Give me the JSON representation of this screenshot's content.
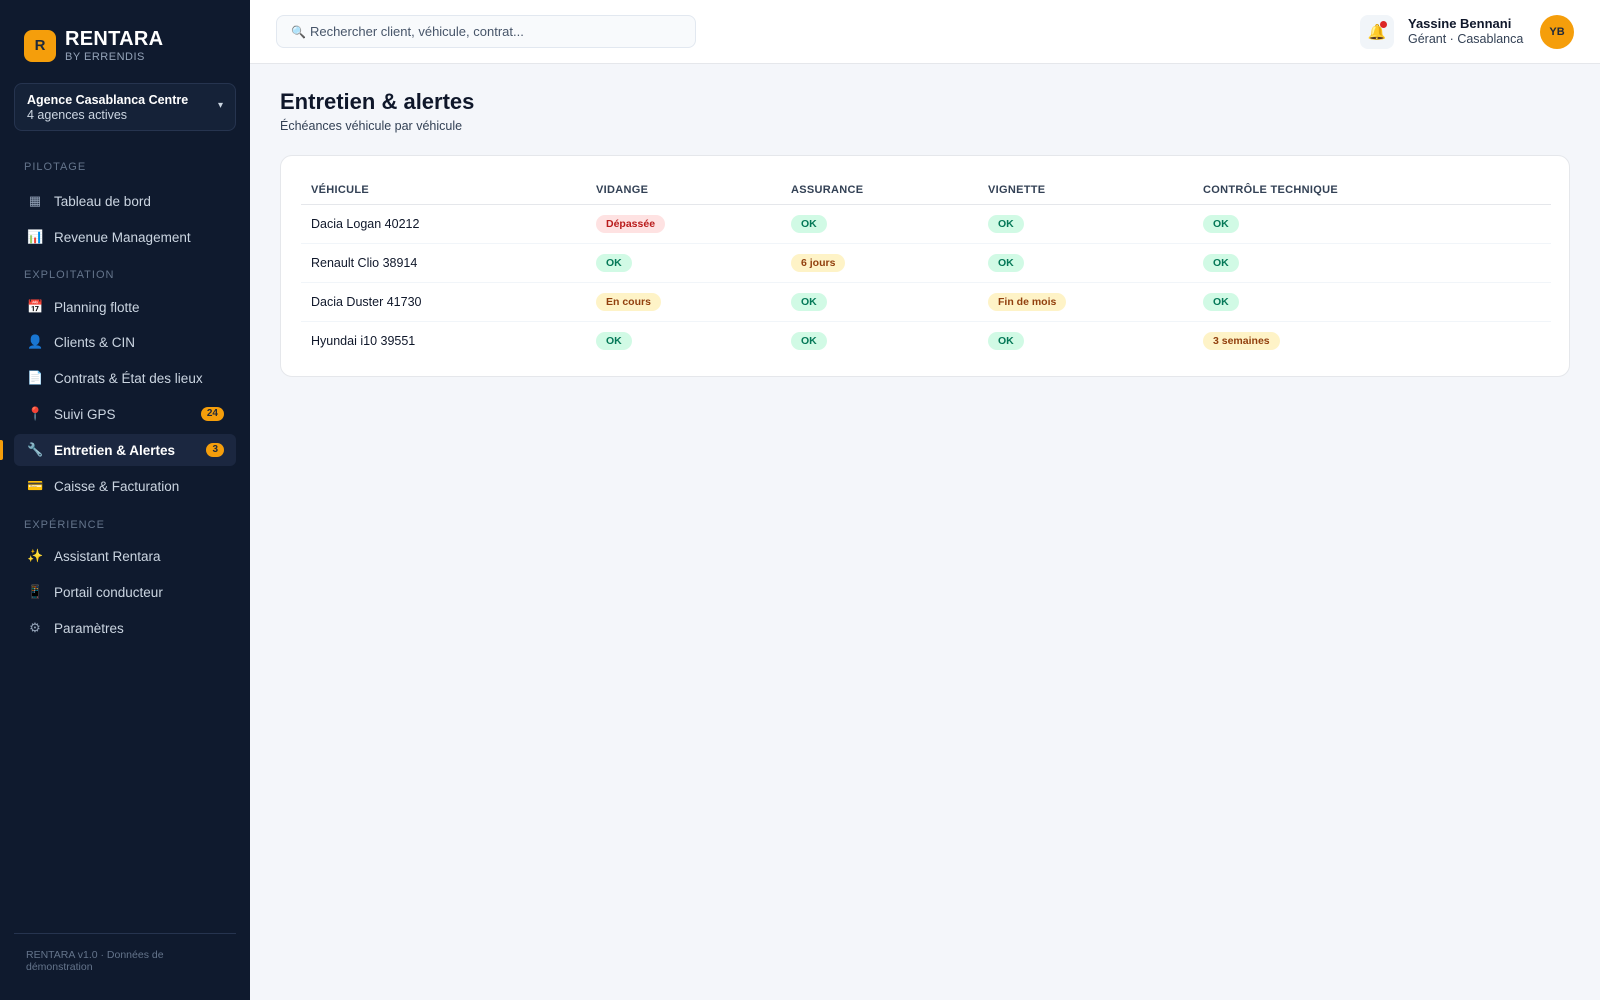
{
  "brand": {
    "logo": "R",
    "name": "RENTARA",
    "sub": "BY ERRENDIS"
  },
  "agency": {
    "name": "Agence Casablanca Centre",
    "sub": "4 agences actives",
    "caret": "▾"
  },
  "sidebar": {
    "sections": [
      "PILOTAGE",
      "EXPLOITATION",
      "EXPÉRIENCE"
    ],
    "items": [
      {
        "icon": "▦",
        "label": "Tableau de bord"
      },
      {
        "icon": "📊",
        "label": "Revenue Management"
      },
      {
        "icon": "📅",
        "label": "Planning flotte"
      },
      {
        "icon": "👤",
        "label": "Clients & CIN"
      },
      {
        "icon": "📄",
        "label": "Contrats & État des lieux"
      },
      {
        "icon": "📍",
        "label": "Suivi GPS",
        "badge": "24"
      },
      {
        "icon": "🔧",
        "label": "Entretien & Alertes",
        "badge": "3",
        "active": true
      },
      {
        "icon": "💳",
        "label": "Caisse & Facturation"
      },
      {
        "icon": "✨",
        "label": "Assistant Rentara"
      },
      {
        "icon": "📱",
        "label": "Portail conducteur"
      },
      {
        "icon": "⚙",
        "label": "Paramètres"
      }
    ],
    "footer": "RENTARA v1.0 · Données de démonstration"
  },
  "topbar": {
    "search_icon": "🔍",
    "search_placeholder": "Rechercher client, véhicule, contrat...",
    "bell_icon": "🔔",
    "user_name": "Yassine Bennani",
    "user_role": "Gérant · Casablanca",
    "avatar": "YB"
  },
  "page": {
    "title": "Entretien & alertes",
    "subtitle": "Échéances véhicule par véhicule"
  },
  "table": {
    "headers": [
      "VÉHICULE",
      "VIDANGE",
      "ASSURANCE",
      "VIGNETTE",
      "CONTRÔLE TECHNIQUE"
    ],
    "rows": [
      [
        "Dacia Logan 40212",
        "Dépassée",
        "OK",
        "OK",
        "OK"
      ],
      [
        "Renault Clio 38914",
        "OK",
        "6 jours",
        "OK",
        "OK"
      ],
      [
        "Dacia Duster 41730",
        "En cours",
        "OK",
        "Fin de mois",
        "OK"
      ],
      [
        "Hyundai i10 39551",
        "OK",
        "OK",
        "OK",
        "3 semaines"
      ]
    ],
    "status": [
      [
        "danger",
        "ok",
        "ok",
        "ok"
      ],
      [
        "ok",
        "warn",
        "ok",
        "ok"
      ],
      [
        "warn",
        "ok",
        "warn",
        "ok"
      ],
      [
        "ok",
        "ok",
        "ok",
        "warn"
      ]
    ]
  },
  "colors": {
    "accent": "#f59e0b",
    "sidebar_bg": "#0f1a2e",
    "ok": "#047857",
    "warn": "#92400e",
    "danger": "#b91c1c"
  }
}
